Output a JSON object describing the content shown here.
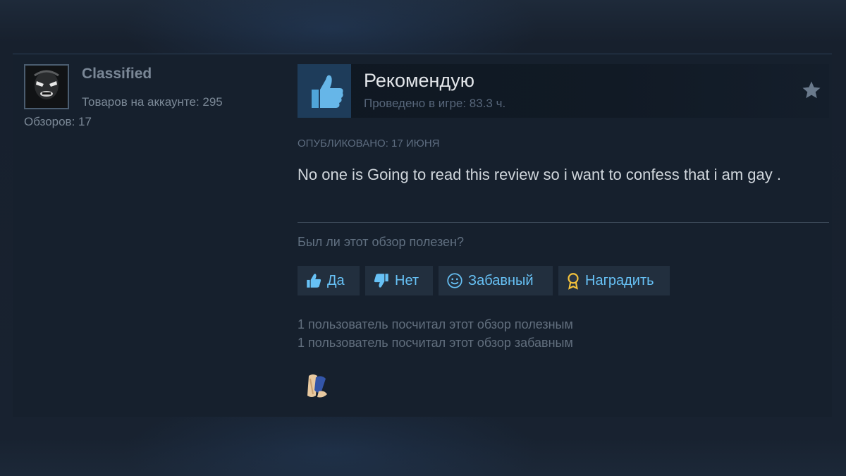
{
  "author": {
    "name": "Classified",
    "products_label": "Товаров на аккаунте: 295",
    "reviews_label": "Обзоров: 17"
  },
  "review": {
    "recommendation": "Рекомендую",
    "hours": "Проведено в игре: 83.3 ч.",
    "posted": "ОПУБЛИКОВАНО: 17 ИЮНЯ",
    "text": "No one is Going to read this review so i want to confess that i am gay .",
    "helpful_question": "Был ли этот обзор полезен?",
    "buttons": {
      "yes": "Да",
      "no": "Нет",
      "funny": "Забавный",
      "award": "Наградить"
    },
    "stats": [
      "1 пользователь посчитал этот обзор полезным",
      "1 пользователь посчитал этот обзор забавным"
    ]
  },
  "icons": {
    "thumb": "thumbs-up-icon",
    "star": "star-icon",
    "yes": "thumbs-up-icon",
    "no": "thumbs-down-icon",
    "funny": "smiley-icon",
    "award": "award-ribbon-icon",
    "received_award": "award-badge-icon"
  },
  "colors": {
    "accent": "#67c1f5",
    "card_bg": "#16202d",
    "thumb_bg": "#1e3c5a"
  }
}
